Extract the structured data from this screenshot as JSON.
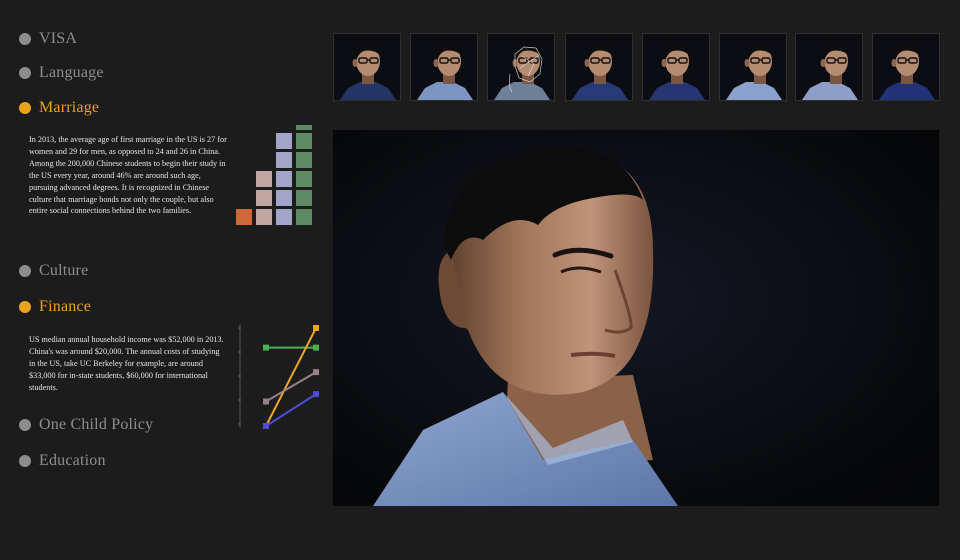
{
  "nav": {
    "visa": "VISA",
    "language": "Language",
    "marriage": "Marriage",
    "culture": "Culture",
    "finance": "Finance",
    "one_child_policy": "One Child Policy",
    "education": "Education"
  },
  "marriage_text": "In 2013, the average age of first marriage in the US is 27 for women and 29 for men, as opposed to 24 and 26 in China. Among the 200,000 Chinese students to begin their study in the US every year, around 46% are around such age, pursuing advanced degrees. It is recognized in Chinese culture that marriage bonds not only the couple, but also entire social connections behind the two families.",
  "finance_text": "US median annual household income was $52,000 in 2013. China's was around $20,000. The annual costs of studying in the US, take UC Berkeley for example, are around $33,000 for in-state students, $60,000 for international students.",
  "colors": {
    "accent": "#e8a21e",
    "inactive_dot": "#8c8c8c",
    "bar_orange": "#d0693a",
    "bar_pink": "#c0a7a2",
    "bar_lavender": "#a4a3ca",
    "bar_green": "#5e8b63",
    "line_green": "#4caf50",
    "line_yellow": "#eaa726",
    "line_mauve": "#9a7f86",
    "line_blue": "#4e4cd6"
  },
  "chart_data": [
    {
      "type": "bar",
      "categories": [
        "1",
        "2",
        "3",
        "4"
      ],
      "values": [
        1,
        3,
        5,
        6
      ],
      "colors": [
        "#d0693a",
        "#c0a7a2",
        "#a4a3ca",
        "#5e8b63"
      ]
    },
    {
      "type": "line",
      "x": [
        0,
        1
      ],
      "series": [
        {
          "color": "#4caf50",
          "values": [
            52,
            52
          ]
        },
        {
          "color": "#eaa726",
          "values": [
            20,
            60
          ]
        },
        {
          "color": "#9a7f86",
          "values": [
            30,
            42
          ]
        },
        {
          "color": "#4e4cd6",
          "values": [
            20,
            33
          ]
        }
      ],
      "ylim": [
        20,
        60
      ]
    }
  ],
  "thumbnails": [
    {
      "shirt": "#233466",
      "turn": 0,
      "tracked": false
    },
    {
      "shirt": "#7d95c3",
      "turn": 4,
      "tracked": false
    },
    {
      "shirt": "#6e7f98",
      "turn": 6,
      "tracked": true
    },
    {
      "shirt": "#273a75",
      "turn": 0,
      "tracked": false
    },
    {
      "shirt": "#263673",
      "turn": 0,
      "tracked": false
    },
    {
      "shirt": "#8aa0ce",
      "turn": 6,
      "tracked": false
    },
    {
      "shirt": "#8e9ec9",
      "turn": 6,
      "tracked": false
    },
    {
      "shirt": "#223276",
      "turn": 0,
      "tracked": false
    }
  ]
}
